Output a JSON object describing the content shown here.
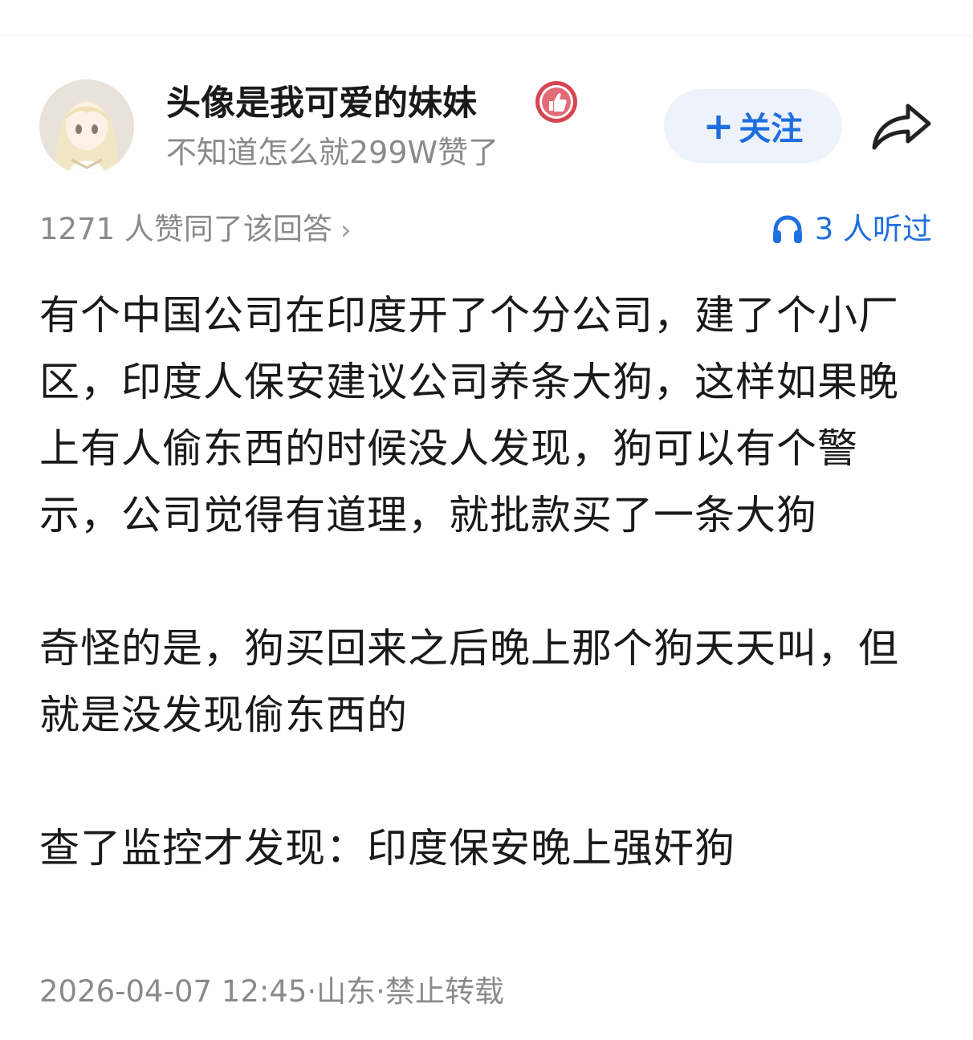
{
  "author": {
    "name": "头像是我可爱的妹妹",
    "bio": "不知道怎么就299W赞了",
    "badge_icon": "thumbs-up-badge-icon",
    "avatar_icon": "anime-girl-avatar"
  },
  "actions": {
    "follow_plus": "+",
    "follow_label": "关注",
    "share_icon": "share-arrow-icon"
  },
  "stats": {
    "likes_text": "1271 人赞同了该回答",
    "likes_chevron": "›",
    "listen_text": "3 人听过",
    "listen_icon": "headphones-icon"
  },
  "content": {
    "paragraphs": [
      "有个中国公司在印度开了个分公司，建了个小厂区，印度人保安建议公司养条大狗，这样如果晚上有人偷东西的时候没人发现，狗可以有个警示，公司觉得有道理，就批款买了一条大狗",
      "奇怪的是，狗买回来之后晚上那个狗天天叫，但就是没发现偷东西的",
      "查了监控才发现：印度保安晚上强奸狗"
    ]
  },
  "footer": {
    "meta": "2026-04-07 12:45·山东·禁止转载"
  },
  "colors": {
    "accent_blue": "#1f6fe0",
    "follow_bg": "#eef3fb",
    "muted_gray": "#8a8a8a",
    "badge_red": "#d64552"
  }
}
